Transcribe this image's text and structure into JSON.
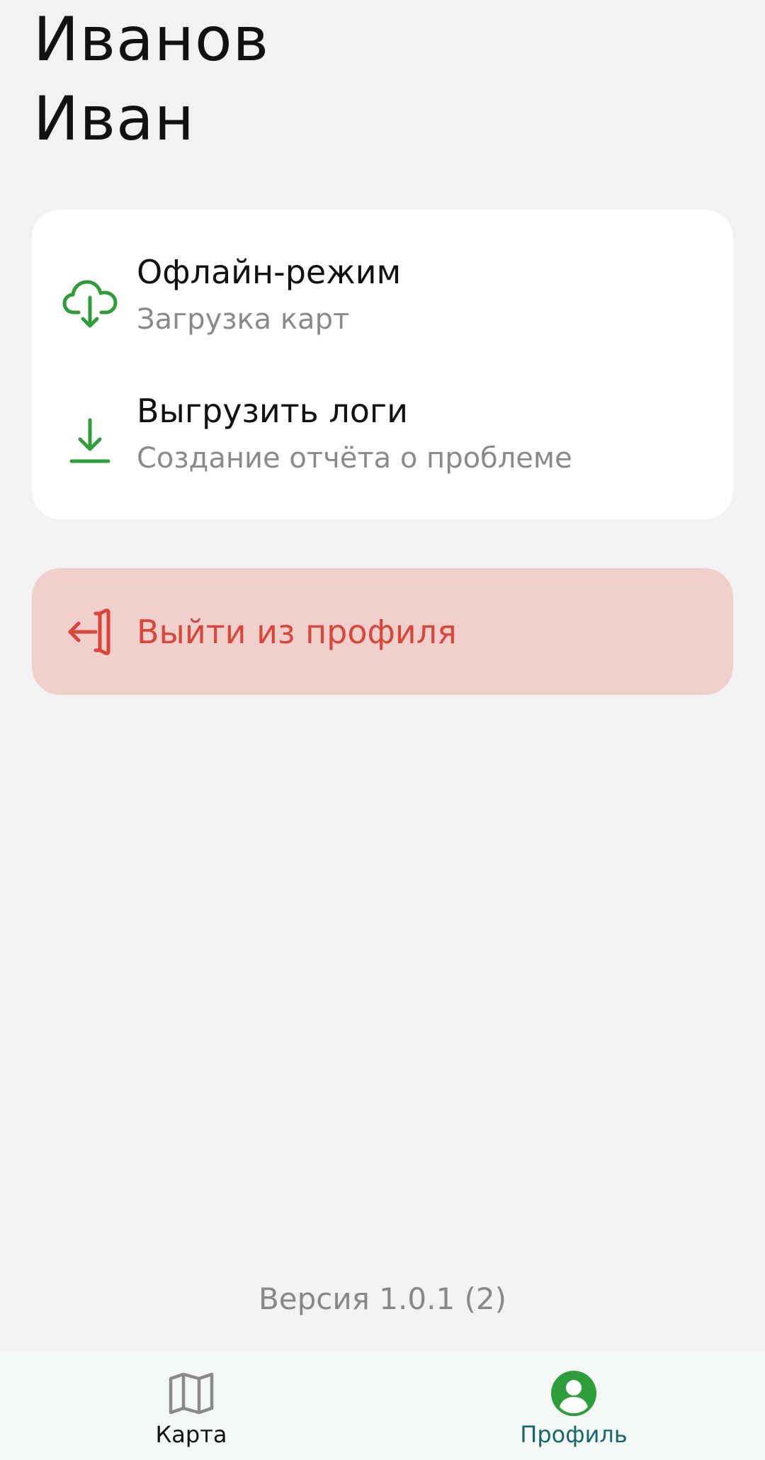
{
  "profile": {
    "last_name": "Иванов",
    "first_name": "Иван"
  },
  "settings": {
    "items": [
      {
        "title": "Офлайн-режим",
        "subtitle": "Загрузка карт",
        "icon": "cloud-download-icon"
      },
      {
        "title": "Выгрузить логи",
        "subtitle": "Создание отчёта о проблеме",
        "icon": "download-icon"
      }
    ]
  },
  "logout": {
    "label": "Выйти из профиля",
    "icon": "logout-icon"
  },
  "version": "Версия 1.0.1 (2)",
  "nav": {
    "items": [
      {
        "label": "Карта",
        "icon": "map-icon",
        "active": false
      },
      {
        "label": "Профиль",
        "icon": "profile-icon",
        "active": true
      }
    ]
  },
  "colors": {
    "background": "#f2f2f2",
    "card": "#ffffff",
    "accent_green": "#2e9e3a",
    "danger": "#d9473b",
    "danger_bg": "#f1cfcc",
    "nav_active": "#17676b",
    "muted": "#8a8a8a"
  }
}
